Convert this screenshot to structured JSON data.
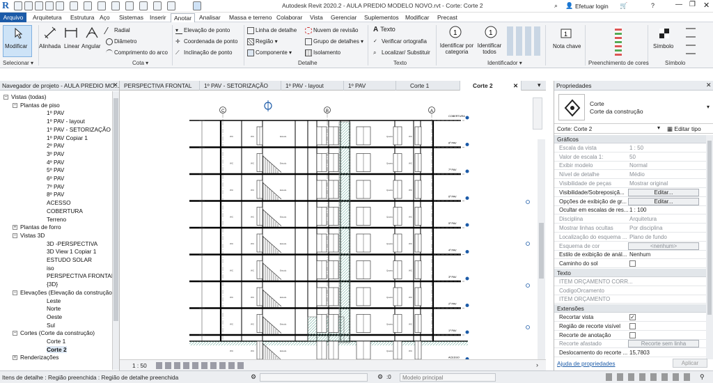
{
  "app": {
    "title": "Autodesk Revit 2020.2 - AULA PREDIO MODELO NOVO.rvt - Corte: Corte 2",
    "login": "Efetuar login"
  },
  "menus": [
    "Arquivo",
    "Arquitetura",
    "Estrutura",
    "Aço",
    "Sistemas",
    "Inserir",
    "Anotar",
    "Analisar",
    "Massa e terreno",
    "Colaborar",
    "Vista",
    "Gerenciar",
    "Suplementos",
    "Modificar",
    "Precast"
  ],
  "ribbon": {
    "modificar": "Modificar",
    "selecionar": "Selecionar ▾",
    "cota_items": [
      "Alinhada",
      "Linear",
      "Angular"
    ],
    "cota_small": [
      "Radial",
      "Diâmetro",
      "Comprimento do arco"
    ],
    "spot": [
      "Elevação de ponto",
      "Coordenada de ponto",
      "Inclinação de ponto"
    ],
    "cota_group": "Cota ▾",
    "detalhe_a": [
      "Linha de detalhe",
      "Região ▾",
      "Componente ▾"
    ],
    "detalhe_b": [
      "Nuvem de revisão",
      "Grupo de detalhes ▾",
      "Isolamento"
    ],
    "detalhe_group": "Detalhe",
    "texto": [
      "Texto",
      "Verificar ortografia",
      "Localizar/ Substituir"
    ],
    "texto_group": "Texto",
    "ident": [
      "Identificar por categoria",
      "Identificar todos"
    ],
    "ident_group": "Identificador ▾",
    "nota": "Nota chave",
    "preench_group": "Preenchimento de cores",
    "simbolo": "Símbolo",
    "simbolo_group": "Símbolo"
  },
  "browser": {
    "title": "Navegador de projeto - AULA PREDIO MO...",
    "items": [
      {
        "t": "Vistas (todas)",
        "l": 0,
        "b": "−"
      },
      {
        "t": "Plantas de piso",
        "l": 1,
        "b": "−"
      },
      {
        "t": "1º PAV",
        "l": 2
      },
      {
        "t": "1º PAV - layout",
        "l": 2
      },
      {
        "t": "1º PAV - SETORIZAÇÃO",
        "l": 2
      },
      {
        "t": "1º PAV Copiar 1",
        "l": 2
      },
      {
        "t": "2º PAV",
        "l": 2
      },
      {
        "t": "3º PAV",
        "l": 2
      },
      {
        "t": "4º PAV",
        "l": 2
      },
      {
        "t": "5º PAV",
        "l": 2
      },
      {
        "t": "6º PAV",
        "l": 2
      },
      {
        "t": "7º PAV",
        "l": 2
      },
      {
        "t": "8º PAV",
        "l": 2
      },
      {
        "t": "ACESSO",
        "l": 2
      },
      {
        "t": "COBERTURA",
        "l": 2
      },
      {
        "t": "Terreno",
        "l": 2
      },
      {
        "t": "Plantas de forro",
        "l": 1,
        "b": "+"
      },
      {
        "t": "Vistas 3D",
        "l": 1,
        "b": "−"
      },
      {
        "t": "3D -PERSPECTIVA",
        "l": 2
      },
      {
        "t": "3D View 1 Copiar 1",
        "l": 2
      },
      {
        "t": "ESTUDO SOLAR",
        "l": 2
      },
      {
        "t": "iso",
        "l": 2
      },
      {
        "t": "PERSPECTIVA FRONTAL",
        "l": 2
      },
      {
        "t": "{3D}",
        "l": 2
      },
      {
        "t": "Elevações (Elevação da construção)",
        "l": 1,
        "b": "−"
      },
      {
        "t": "Leste",
        "l": 2
      },
      {
        "t": "Norte",
        "l": 2
      },
      {
        "t": "Oeste",
        "l": 2
      },
      {
        "t": "Sul",
        "l": 2
      },
      {
        "t": "Cortes (Corte da construção)",
        "l": 1,
        "b": "−"
      },
      {
        "t": "Corte 1",
        "l": 2
      },
      {
        "t": "Corte 2",
        "l": 2,
        "bold": true
      },
      {
        "t": "Renderizações",
        "l": 1,
        "b": "+"
      }
    ]
  },
  "tabs": [
    "PERSPECTIVA FRONTAL",
    "1º PAV - SETORIZAÇÃO",
    "1º PAV - layout",
    "1º PAV",
    "Corte 1",
    "Corte 2"
  ],
  "drawing": {
    "grids": [
      "C",
      "B",
      "A"
    ],
    "levels": [
      "COBERTURA",
      "8º PAV",
      "7º PAV",
      "6º PAV",
      "5º PAV",
      "4º PAV",
      "3º PAV",
      "2º PAV",
      "1º PAV",
      "ACESSO"
    ]
  },
  "viewbar": {
    "scale": "1 : 50"
  },
  "props": {
    "title": "Propriedades",
    "type1": "Corte",
    "type2": "Corte da construção",
    "selector": "Corte: Corte 2",
    "edit_type": "Editar tipo",
    "sec_graficos": "Gráficos",
    "rows": [
      {
        "k": "Escala da vista",
        "v": "1 : 50",
        "g": true
      },
      {
        "k": "Valor de escala    1:",
        "v": "50",
        "g": true
      },
      {
        "k": "Exibir modelo",
        "v": "Normal",
        "g": true
      },
      {
        "k": "Nível de detalhe",
        "v": "Médio",
        "g": true
      },
      {
        "k": "Visibilidade de peças",
        "v": "Mostrar original",
        "g": true
      },
      {
        "k": "Visibilidade/Sobreposiçã...",
        "btn": "Editar..."
      },
      {
        "k": "Opções de exibição de gr...",
        "btn": "Editar..."
      },
      {
        "k": "Ocultar em escalas de res...",
        "v": "1 : 100"
      },
      {
        "k": "Disciplina",
        "v": "Arquitetura",
        "g": true
      },
      {
        "k": "Mostrar linhas ocultas",
        "v": "Por disciplina",
        "g": true
      },
      {
        "k": "Localização do esquema ...",
        "v": "Plano de fundo",
        "g": true
      },
      {
        "k": "Esquema de cor",
        "btn": "<nenhum>",
        "g": true
      },
      {
        "k": "Estilo de exibição de anál...",
        "v": "Nenhum"
      },
      {
        "k": "Caminho do sol",
        "cb": false
      }
    ],
    "sec_texto": "Texto",
    "texto_rows": [
      "ITEM ORÇAMENTO CORR...",
      "CodigoOrcamento",
      "ITEM ORÇAMENTO"
    ],
    "sec_ext": "Extensões",
    "ext_rows": [
      {
        "k": "Recortar vista",
        "cb": true
      },
      {
        "k": "Região de recorte visível",
        "cb": false
      },
      {
        "k": "Recorte de anotação",
        "cb": false
      },
      {
        "k": "Recorte afastado",
        "btn": "Recorte sem linha",
        "g": true
      },
      {
        "k": "Deslocamento do recorte ...",
        "v": "15,7803"
      }
    ],
    "help": "Ajuda de propriedades",
    "apply": "Aplicar"
  },
  "status": {
    "text": "Itens de detalhe : Região preenchida : Região de detalhe preenchida",
    "model": "Modelo principal",
    "zero": ":0"
  }
}
